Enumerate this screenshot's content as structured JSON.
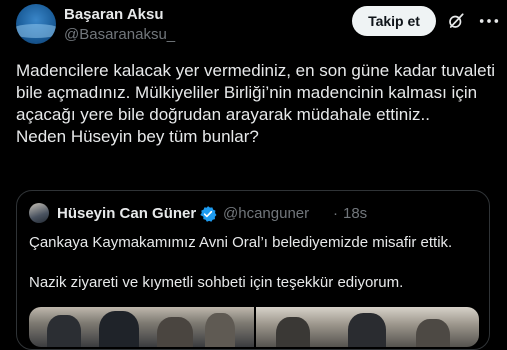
{
  "author": {
    "name": "Başaran Aksu",
    "handle": "@Basaranaksu_"
  },
  "header": {
    "follow_label": "Takip et",
    "icons": [
      "grok-icon",
      "more-icon"
    ]
  },
  "tweet": {
    "text": "Madencilere kalacak yer vermediniz, en son güne kadar tuvaleti bile açmadınız. Mülkiyeliler Birliği’nin madencinin kalması için açacağı yere bile doğrudan arayarak müdahale ettiniz..\nNeden Hüseyin bey tüm bunlar?"
  },
  "quote": {
    "name": "Hüseyin Can Güner",
    "handle": "@hcanguner",
    "separator": "·",
    "time": "18s",
    "text": "Çankaya Kaymakamımız Avni Oral’ı belediyemizde misafir ettik.\n\nNazik ziyareti ve kıymetli sohbeti için teşekkür ediyorum.",
    "verified_color": "#1d9bf0"
  },
  "colors": {
    "background": "#000000",
    "text": "#e7e9ea",
    "muted": "#71767b",
    "border": "#2f3336",
    "follow_bg": "#eff3f4"
  }
}
